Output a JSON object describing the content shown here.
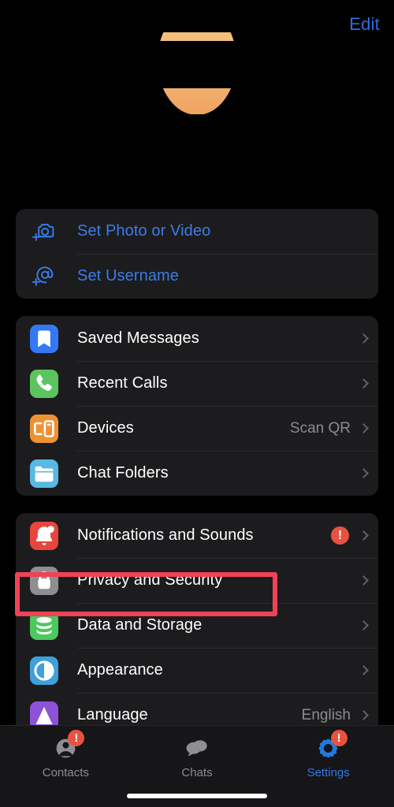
{
  "header": {
    "edit_label": "Edit",
    "display_name": " ",
    "phone_number": " ",
    "avatar_name": "profile-avatar"
  },
  "sections": [
    {
      "id": "profile-setup",
      "rows": [
        {
          "name": "set-photo-or-video",
          "icon": "camera-plus-icon",
          "label": "Set Photo or Video",
          "style": "blue",
          "value": "",
          "badge": "",
          "chevron": false
        },
        {
          "name": "set-username",
          "icon": "at-plus-icon",
          "label": "Set Username",
          "style": "blue",
          "value": "",
          "badge": "",
          "chevron": false
        }
      ]
    },
    {
      "id": "shortcuts",
      "rows": [
        {
          "name": "saved-messages",
          "icon": "bookmark-icon",
          "label": "Saved Messages",
          "style": "plain",
          "value": "",
          "badge": "",
          "chevron": true
        },
        {
          "name": "recent-calls",
          "icon": "phone-icon",
          "label": "Recent Calls",
          "style": "plain",
          "value": "",
          "badge": "",
          "chevron": true
        },
        {
          "name": "devices",
          "icon": "devices-icon",
          "label": "Devices",
          "style": "plain",
          "value": "Scan QR",
          "badge": "",
          "chevron": true
        },
        {
          "name": "chat-folders",
          "icon": "folder-icon",
          "label": "Chat Folders",
          "style": "plain",
          "value": "",
          "badge": "",
          "chevron": true
        }
      ]
    },
    {
      "id": "settings",
      "rows": [
        {
          "name": "notifications-and-sounds",
          "icon": "bell-icon",
          "label": "Notifications and Sounds",
          "style": "plain",
          "value": "",
          "badge": "!",
          "chevron": true
        },
        {
          "name": "privacy-and-security",
          "icon": "lock-icon",
          "label": "Privacy and Security",
          "style": "plain",
          "value": "",
          "badge": "",
          "chevron": true
        },
        {
          "name": "data-and-storage",
          "icon": "database-icon",
          "label": "Data and Storage",
          "style": "plain",
          "value": "",
          "badge": "",
          "chevron": true
        },
        {
          "name": "appearance",
          "icon": "appearance-icon",
          "label": "Appearance",
          "style": "plain",
          "value": "",
          "badge": "",
          "chevron": true
        },
        {
          "name": "language",
          "icon": "language-icon",
          "label": "Language",
          "style": "plain",
          "value": "English",
          "badge": "",
          "chevron": true
        }
      ]
    }
  ],
  "highlight": {
    "target": "privacy-and-security",
    "color": "#f04257"
  },
  "tabbar": {
    "tabs": [
      {
        "name": "tab-contacts",
        "label": "Contacts",
        "icon": "contacts-icon",
        "badge": "!",
        "active": false
      },
      {
        "name": "tab-chats",
        "label": "Chats",
        "icon": "chats-icon",
        "badge": "",
        "active": false
      },
      {
        "name": "tab-settings",
        "label": "Settings",
        "icon": "gear-icon",
        "badge": "!",
        "active": true
      }
    ]
  },
  "colors": {
    "accent_blue": "#3b7ce8",
    "card_bg": "#1c1c1e",
    "page_bg": "#000000",
    "badge_red": "#e8523f",
    "highlight_red": "#f04257",
    "icon_saved_messages": "#3478f6",
    "icon_recent_calls": "#5cc45f",
    "icon_devices": "#ef9233",
    "icon_chat_folders": "#57b9e4",
    "icon_notifications": "#e8453c",
    "icon_privacy": "#8e8e93",
    "icon_data_storage": "#4cc95f",
    "icon_appearance": "#3fa0dc",
    "icon_language": "#8c52d8"
  }
}
